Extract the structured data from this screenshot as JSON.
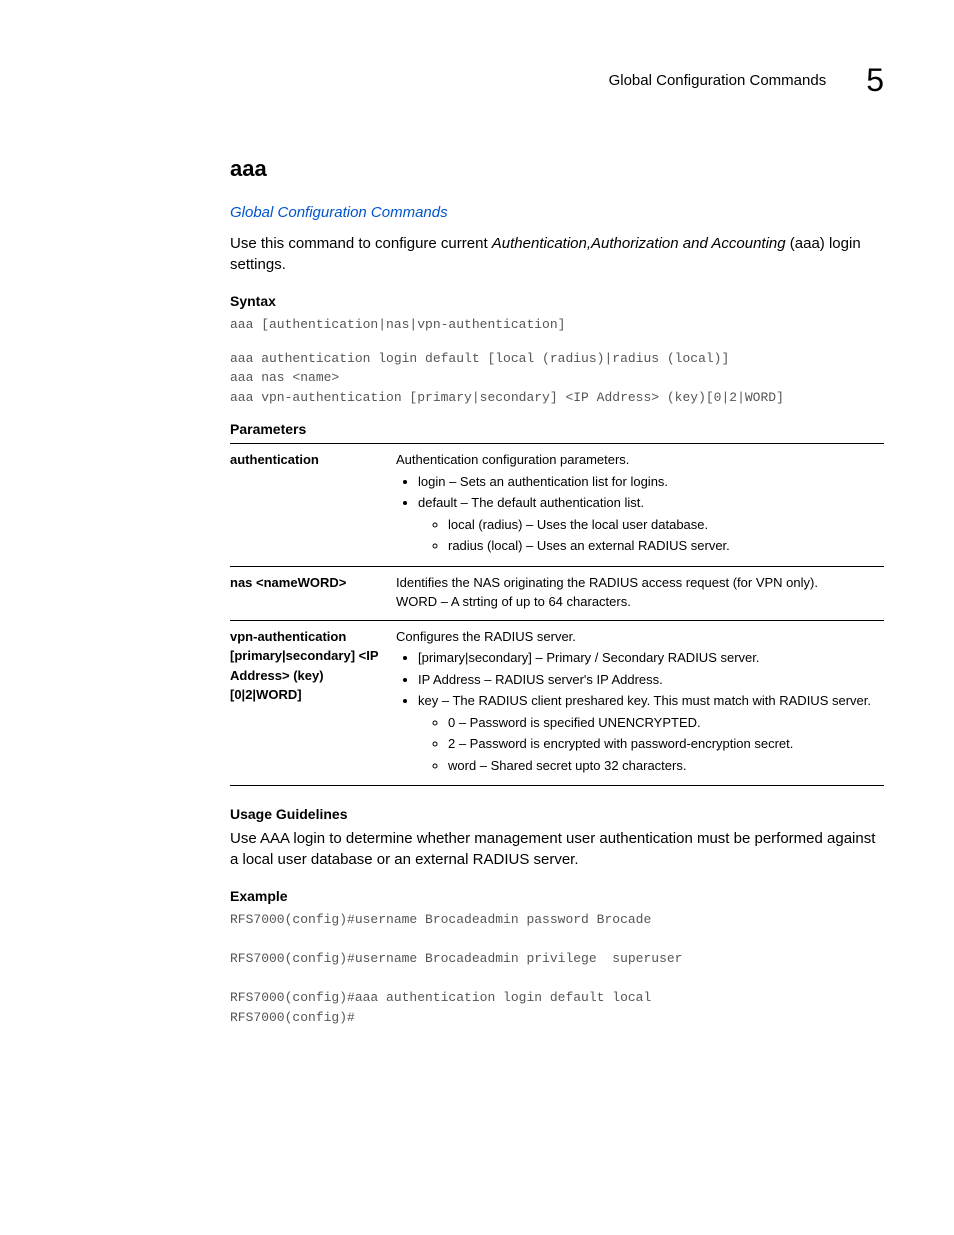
{
  "header": {
    "running_title": "Global Configuration Commands",
    "chapter_number": "5"
  },
  "section": {
    "title": "aaa",
    "link": "Global Configuration Commands",
    "intro_prefix": "Use this command to configure current",
    "intro_em": "Authentication,Authorization and Accounting",
    "intro_suffix": "(aaa) login settings."
  },
  "syntax": {
    "heading": "Syntax",
    "block1": "aaa [authentication|nas|vpn-authentication]",
    "block2": "aaa authentication login default [local (radius)|radius (local)]\naaa nas <name>\naaa vpn-authentication [primary|secondary] <IP Address> (key)[0|2|WORD]"
  },
  "parameters": {
    "heading": "Parameters",
    "rows": [
      {
        "term": "authentication",
        "desc": "Authentication configuration parameters.",
        "bullets": [
          "login – Sets an authentication list for logins.",
          "default – The default authentication list."
        ],
        "sub_bullets": [
          "local (radius) – Uses the local user database.",
          "radius (local) – Uses an external RADIUS server."
        ]
      },
      {
        "term": "nas <nameWORD>",
        "desc_line1": "Identifies the NAS originating the RADIUS access request (for VPN only).",
        "desc_line2": "WORD – A strting of up to 64 characters."
      },
      {
        "term": "vpn-authentication [primary|secondary] <IP Address> (key) [0|2|WORD]",
        "desc": "Configures the RADIUS server.",
        "bullets": [
          "[primary|secondary] – Primary / Secondary RADIUS server.",
          "IP Address – RADIUS server's IP Address.",
          "key – The RADIUS client preshared key. This must match with RADIUS server."
        ],
        "sub_bullets": [
          "0 – Password is specified UNENCRYPTED.",
          "2 – Password is encrypted with password-encryption secret.",
          "word – Shared secret upto 32 characters."
        ]
      }
    ]
  },
  "usage": {
    "heading": "Usage Guidelines",
    "text": "Use AAA login to determine whether management user authentication must be performed against a local user database or an external RADIUS server."
  },
  "example": {
    "heading": "Example",
    "code": "RFS7000(config)#username Brocadeadmin password Brocade\n\nRFS7000(config)#username Brocadeadmin privilege  superuser\n\nRFS7000(config)#aaa authentication login default local\nRFS7000(config)#"
  }
}
